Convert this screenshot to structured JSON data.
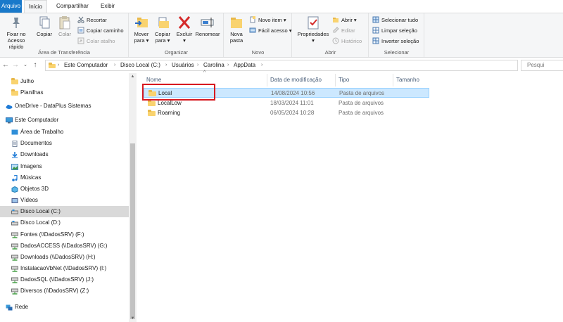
{
  "tabs": {
    "file": "Arquivo",
    "home": "Início",
    "share": "Compartilhar",
    "view": "Exibir"
  },
  "ribbon": {
    "clipboard": {
      "label": "Área de Transferência",
      "pin": "Fixar no Acesso rápido",
      "copy": "Copiar",
      "paste": "Colar",
      "cut": "Recortar",
      "copy_path": "Copiar caminho",
      "paste_shortcut": "Colar atalho"
    },
    "organize": {
      "label": "Organizar",
      "move_to": "Mover para",
      "copy_to": "Copiar para",
      "delete": "Excluir",
      "rename": "Renomear"
    },
    "new": {
      "label": "Novo",
      "new_folder": "Nova pasta",
      "new_item": "Novo item",
      "easy_access": "Fácil acesso"
    },
    "open": {
      "label": "Abrir",
      "properties": "Propriedades",
      "open": "Abrir",
      "edit": "Editar",
      "history": "Histórico"
    },
    "select": {
      "label": "Selecionar",
      "select_all": "Selecionar tudo",
      "select_none": "Limpar seleção",
      "invert": "Inverter seleção"
    }
  },
  "address": {
    "crumbs": [
      "Este Computador",
      "Disco Local (C:)",
      "Usuários",
      "Carolina",
      "AppData"
    ],
    "search_placeholder": "Pesqui"
  },
  "nav": {
    "items": [
      {
        "label": "Julho",
        "icon": "folder-icon"
      },
      {
        "label": "Planilhas",
        "icon": "folder-icon"
      },
      {
        "label": "OneDrive - DataPlus Sistemas",
        "icon": "cloud-icon"
      },
      {
        "label": "Este Computador",
        "icon": "computer-icon"
      },
      {
        "label": "Área de Trabalho",
        "icon": "desktop-icon"
      },
      {
        "label": "Documentos",
        "icon": "documents-icon"
      },
      {
        "label": "Downloads",
        "icon": "downloads-icon"
      },
      {
        "label": "Imagens",
        "icon": "pictures-icon"
      },
      {
        "label": "Músicas",
        "icon": "music-icon"
      },
      {
        "label": "Objetos 3D",
        "icon": "3d-objects-icon"
      },
      {
        "label": "Vídeos",
        "icon": "videos-icon"
      },
      {
        "label": "Disco Local (C:)",
        "icon": "drive-icon"
      },
      {
        "label": "Disco Local (D:)",
        "icon": "drive-icon"
      },
      {
        "label": "Fontes (\\\\DadosSRV) (F:)",
        "icon": "network-drive-icon"
      },
      {
        "label": "DadosACCESS (\\\\DadosSRV) (G:)",
        "icon": "network-drive-icon"
      },
      {
        "label": "Downloads (\\\\DadosSRV) (H:)",
        "icon": "network-drive-icon"
      },
      {
        "label": "InstalacaoVbNet (\\\\DadosSRV) (I:)",
        "icon": "network-drive-icon"
      },
      {
        "label": "DadosSQL (\\\\DadosSRV) (J:)",
        "icon": "network-drive-icon"
      },
      {
        "label": "Diversos (\\\\DadosSRV) (Z:)",
        "icon": "network-drive-icon"
      },
      {
        "label": "Rede",
        "icon": "network-icon"
      }
    ]
  },
  "columns": {
    "name": "Nome",
    "date": "Data de modificação",
    "type": "Tipo",
    "size": "Tamanho"
  },
  "files": [
    {
      "name": "Local",
      "date": "14/08/2024 10:56",
      "type": "Pasta de arquivos"
    },
    {
      "name": "LocalLow",
      "date": "18/03/2024 11:01",
      "type": "Pasta de arquivos"
    },
    {
      "name": "Roaming",
      "date": "06/05/2024 10:28",
      "type": "Pasta de arquivos"
    }
  ],
  "colors": {
    "file_tab": "#1979ca",
    "selection": "#cce8ff",
    "highlight": "#d71920",
    "folder": "#f9d36f"
  }
}
